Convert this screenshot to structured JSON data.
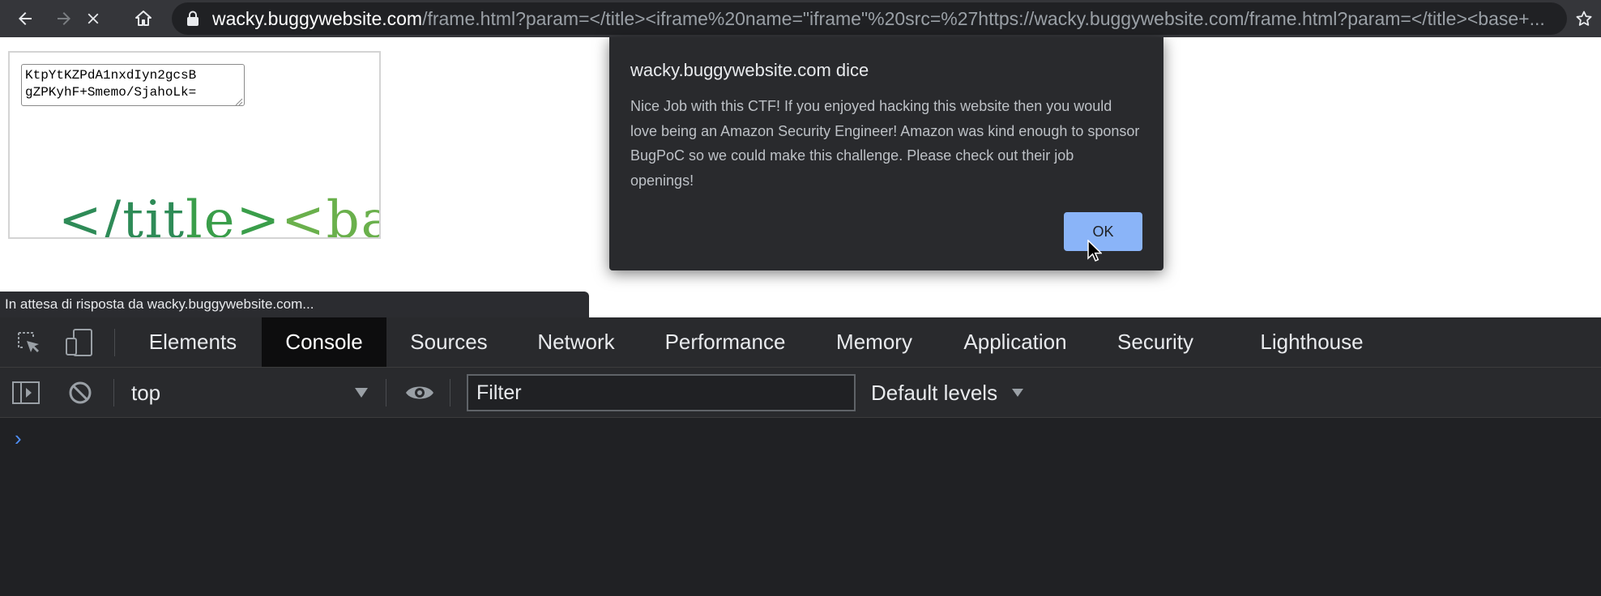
{
  "browser": {
    "url_host": "wacky.buggywebsite.com",
    "url_path": "/frame.html?param=</title><iframe%20name=\"iframe\"%20src=%27https://wacky.buggywebsite.com/frame.html?param=</title><base+...",
    "icons": [
      "back-icon",
      "forward-icon",
      "stop-icon",
      "home-icon",
      "lock-icon",
      "star-icon"
    ]
  },
  "page": {
    "textarea_value": "KtpYtKZPdA1nxdIyn2gcsB\ngZPKyhF+Smemo/SjahoLk=",
    "captcha": {
      "part1": "</tit",
      "part2": "le>",
      "part3": "<base"
    }
  },
  "dialog": {
    "title": "wacky.buggywebsite.com dice",
    "message": "Nice Job with this CTF! If you enjoyed hacking this website then you would love being an Amazon Security Engineer! Amazon was kind enough to sponsor BugPoC so we could make this challenge. Please check out their job openings!",
    "ok_label": "OK",
    "accent": "#8ab4f8"
  },
  "status_bar": {
    "text": "In attesa di risposta da wacky.buggywebsite.com..."
  },
  "devtools": {
    "tabs": [
      {
        "label": "Elements"
      },
      {
        "label": "Console",
        "active": true
      },
      {
        "label": "Sources"
      },
      {
        "label": "Network"
      },
      {
        "label": "Performance"
      },
      {
        "label": "Memory"
      },
      {
        "label": "Application"
      },
      {
        "label": "Security"
      },
      {
        "label": "Lighthouse"
      }
    ],
    "console": {
      "context": "top",
      "filter_placeholder": "Filter",
      "levels": "Default levels",
      "prompt": "›"
    }
  }
}
